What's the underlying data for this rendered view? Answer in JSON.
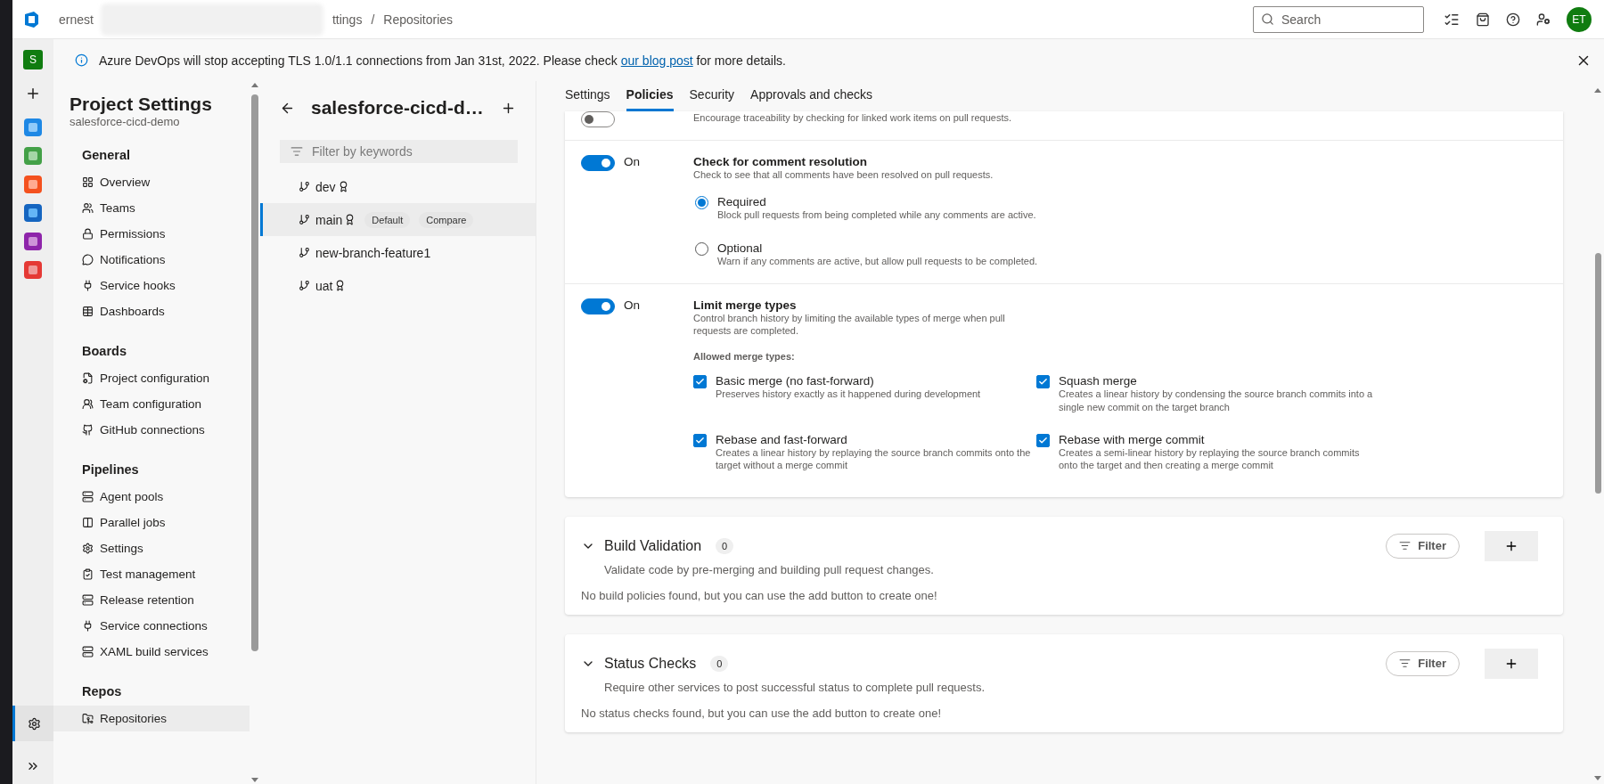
{
  "top_bar": {
    "breadcrumb": [
      "ernest",
      "ttings",
      "Repositories"
    ],
    "separator": "/",
    "search": {
      "placeholder": "Search"
    },
    "avatar": "ET"
  },
  "rail": {
    "org_initial": "S"
  },
  "banner": {
    "text": "Azure DevOps will stop accepting TLS 1.0/1.1 connections from Jan 31st, 2022. Please check ",
    "link": "our blog post",
    "after": " for more details."
  },
  "settings_sidebar": {
    "title": "Project Settings",
    "subtitle": "salesforce-cicd-demo",
    "groups": [
      {
        "heading": "General",
        "items": [
          {
            "label": "Overview",
            "selected": false
          },
          {
            "label": "Teams",
            "selected": false
          },
          {
            "label": "Permissions",
            "selected": false
          },
          {
            "label": "Notifications",
            "selected": false
          },
          {
            "label": "Service hooks",
            "selected": false
          },
          {
            "label": "Dashboards",
            "selected": false
          }
        ]
      },
      {
        "heading": "Boards",
        "items": [
          {
            "label": "Project configuration",
            "selected": false
          },
          {
            "label": "Team configuration",
            "selected": false
          },
          {
            "label": "GitHub connections",
            "selected": false
          }
        ]
      },
      {
        "heading": "Pipelines",
        "items": [
          {
            "label": "Agent pools",
            "selected": false
          },
          {
            "label": "Parallel jobs",
            "selected": false
          },
          {
            "label": "Settings",
            "selected": false
          },
          {
            "label": "Test management",
            "selected": false
          },
          {
            "label": "Release retention",
            "selected": false
          },
          {
            "label": "Service connections",
            "selected": false
          },
          {
            "label": "XAML build services",
            "selected": false
          }
        ]
      },
      {
        "heading": "Repos",
        "items": [
          {
            "label": "Repositories",
            "selected": true
          }
        ]
      }
    ]
  },
  "branches": {
    "title": "salesforce-cicd-d…",
    "filter": {
      "placeholder": "Filter by keywords"
    },
    "items": [
      {
        "name": "dev",
        "has_policy": true,
        "selected": false
      },
      {
        "name": "main",
        "has_policy": true,
        "selected": true,
        "badges": [
          "Default",
          "Compare"
        ]
      },
      {
        "name": "new-branch-feature1",
        "has_policy": false,
        "selected": false
      },
      {
        "name": "uat",
        "has_policy": true,
        "selected": false
      }
    ]
  },
  "tabs": [
    {
      "label": "Settings",
      "selected": false
    },
    {
      "label": "Policies",
      "selected": true
    },
    {
      "label": "Security",
      "selected": false
    },
    {
      "label": "Approvals and checks",
      "selected": false
    }
  ],
  "policies": [
    {
      "kind": "plain",
      "on": false,
      "description": "Encourage traceability by checking for linked work items on pull requests."
    },
    {
      "kind": "radios",
      "on": true,
      "state_label": "On",
      "title": "Check for comment resolution",
      "description": "Check to see that all comments have been resolved on pull requests.",
      "options": [
        {
          "label": "Required",
          "description": "Block pull requests from being completed while any comments are active.",
          "selected": true
        },
        {
          "label": "Optional",
          "description": "Warn if any comments are active, but allow pull requests to be completed.",
          "selected": false
        }
      ]
    },
    {
      "kind": "checkboxes",
      "on": true,
      "state_label": "On",
      "title": "Limit merge types",
      "description": "Control branch history by limiting the available types of merge when pull requests are completed.",
      "subheading": "Allowed merge types:",
      "options": [
        {
          "label": "Basic merge (no fast-forward)",
          "description": "Preserves history exactly as it happened during development",
          "checked": true
        },
        {
          "label": "Squash merge",
          "description": "Creates a linear history by condensing the source branch commits into a single new commit on the target branch",
          "checked": true
        },
        {
          "label": "Rebase and fast-forward",
          "description": "Creates a linear history by replaying the source branch commits onto the target without a merge commit",
          "checked": true
        },
        {
          "label": "Rebase with merge commit",
          "description": "Creates a semi-linear history by replaying the source branch commits onto the target and then creating a merge commit",
          "checked": true
        }
      ]
    }
  ],
  "cards": [
    {
      "title": "Build Validation",
      "count": "0",
      "description": "Validate code by pre-merging and building pull request changes.",
      "empty_text": "No build policies found, but you can use the add button to create one!",
      "filter_label": "Filter"
    },
    {
      "title": "Status Checks",
      "count": "0",
      "description": "Require other services to post successful status to complete pull requests.",
      "empty_text": "No status checks found, but you can use the add button to create one!",
      "filter_label": "Filter"
    }
  ]
}
